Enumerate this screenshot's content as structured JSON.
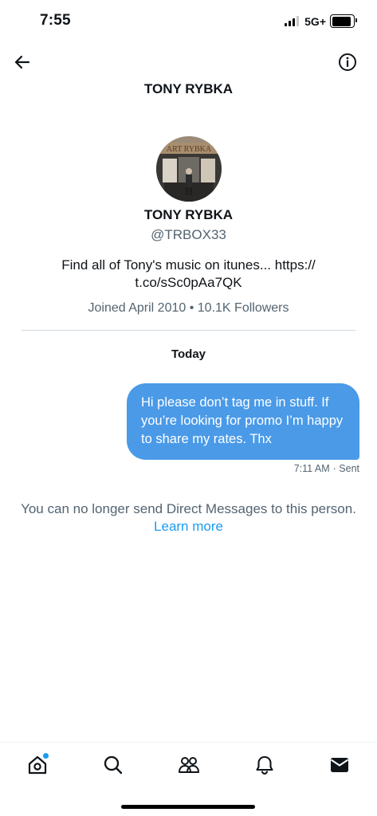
{
  "status_bar": {
    "time": "7:55",
    "network": "5G+",
    "signal_bars": 3,
    "battery_level": 0.9
  },
  "header": {
    "title": "TONY RYBKA",
    "back_icon": "arrow-left-icon",
    "info_icon": "info-icon"
  },
  "profile": {
    "name": "TONY RYBKA",
    "handle": "@TRBOX33",
    "bio_line1": "Find all of Tony's music on itunes... https://",
    "bio_line2": "t.co/sSc0pAa7QK",
    "joined": "Joined April 2010",
    "separator": "•",
    "followers": "10.1K Followers",
    "avatar_sign_text": "ART RYBKA"
  },
  "conversation": {
    "date_label": "Today",
    "messages": [
      {
        "text": "Hi please don’t tag me in stuff. If you’re looking for promo I’m happy to share my rates. Thx",
        "time": "7:11 AM",
        "status": "· Sent"
      }
    ],
    "notice": "You can no longer send Direct Messages to this person.",
    "learn_more": "Learn more"
  },
  "tabbar": {
    "tabs": [
      {
        "icon": "home-icon",
        "has_notification_dot": true
      },
      {
        "icon": "search-icon"
      },
      {
        "icon": "communities-icon"
      },
      {
        "icon": "bell-icon"
      },
      {
        "icon": "mail-icon",
        "active": true
      }
    ]
  },
  "colors": {
    "accent": "#1d9bf0",
    "bubble": "#4a9ae8",
    "secondary_text": "#536471"
  }
}
